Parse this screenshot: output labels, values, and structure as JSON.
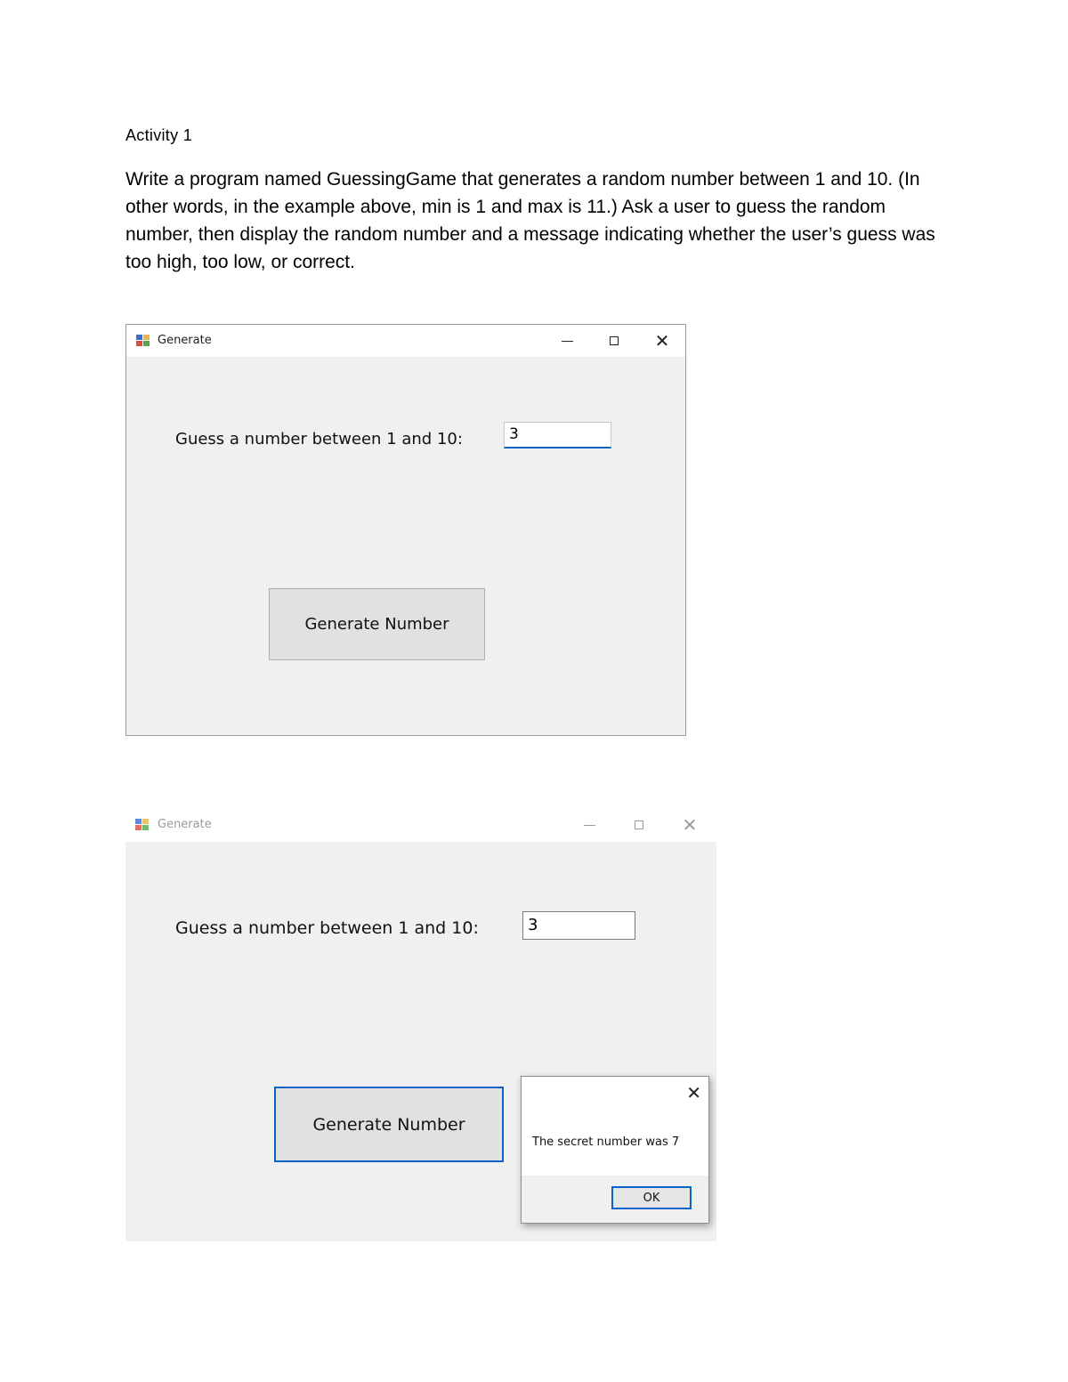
{
  "doc": {
    "heading": "Activity 1",
    "paragraph": "Write a program named GuessingGame that generates a random number between 1 and 10. (In other words, in the example above, min is 1 and max is 11.) Ask a user to guess the random number, then display the random number and a message indicating whether the user’s guess was too high, too low, or correct."
  },
  "window1": {
    "title": "Generate",
    "minimize_glyph": "—",
    "close_glyph": "✕",
    "prompt_label": "Guess a number between 1 and 10:",
    "input_value": "3",
    "button_label": "Generate Number"
  },
  "window2": {
    "title": "Generate",
    "prompt_label": "Guess a number between 1 and 10:",
    "input_value": "3",
    "button_label": "Generate Number",
    "message_box": {
      "text": "The secret number was 7",
      "ok_label": "OK",
      "close_glyph": "✕"
    }
  },
  "colors": {
    "window_bg": "#f0f0f0",
    "focus_blue": "#0a64c8"
  },
  "icons": [
    "app-icon",
    "minimize-icon",
    "maximize-icon",
    "close-icon"
  ]
}
